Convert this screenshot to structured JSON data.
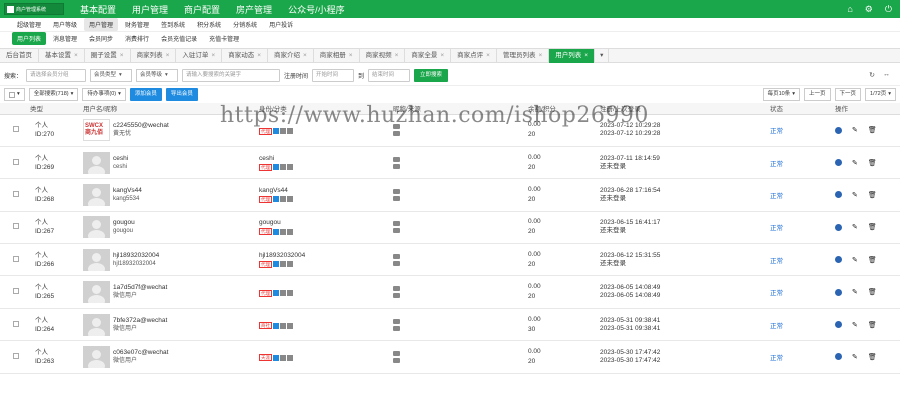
{
  "app": {
    "logo_text": "商户管理系统",
    "top_nav": [
      "基本配置",
      "用户管理",
      "商户配置",
      "房产管理",
      "公众号/小程序"
    ],
    "top_icons": [
      "home-icon",
      "gear-icon",
      "power-icon"
    ]
  },
  "subnav1": [
    "超级管理",
    "用户等级",
    "用户管理",
    "财务管理",
    "签到系统",
    "积分系统",
    "分销系统",
    "用户投诉"
  ],
  "subnav2": [
    "用户列表",
    "消息管理",
    "会员同步",
    "消费排行",
    "会员充值记录",
    "充值卡管理"
  ],
  "tabs": [
    {
      "label": "后台首页",
      "closable": false,
      "active": false
    },
    {
      "label": "基本设置",
      "closable": true,
      "active": false
    },
    {
      "label": "圈子设置",
      "closable": true,
      "active": false
    },
    {
      "label": "商家列表",
      "closable": true,
      "active": false
    },
    {
      "label": "入驻订单",
      "closable": true,
      "active": false
    },
    {
      "label": "商家动态",
      "closable": true,
      "active": false
    },
    {
      "label": "商家介绍",
      "closable": true,
      "active": false
    },
    {
      "label": "商家相册",
      "closable": true,
      "active": false
    },
    {
      "label": "商家视频",
      "closable": true,
      "active": false
    },
    {
      "label": "商家全景",
      "closable": true,
      "active": false
    },
    {
      "label": "商家点评",
      "closable": true,
      "active": false
    },
    {
      "label": "管理员列表",
      "closable": true,
      "active": false
    },
    {
      "label": "用户列表",
      "closable": true,
      "active": true
    }
  ],
  "search": {
    "label": "搜索：",
    "keyword_placeholder": "请选择会员分组",
    "member_type": "会员类型",
    "member_level": "会员等级",
    "input_placeholder": "请输入要搜索的关键字",
    "reg_time_label": "注册时间",
    "start_placeholder": "开始时间",
    "to": "到",
    "end_placeholder": "结束时间",
    "search_button": "立即搜索"
  },
  "actions": {
    "select_all": "全部搜索(718)",
    "batch": "待办事项(0)",
    "add_member": "添加会员",
    "import_member": "导出会员",
    "per_page": "每页10条",
    "prev": "上一页",
    "next": "下一页",
    "page": "1/72页"
  },
  "table": {
    "headers": [
      "类型",
      "用户名/昵称",
      "身份/分类",
      "昵称/来源",
      "余额/积分",
      "注册/上次登录",
      "状态",
      "操作"
    ],
    "rows": [
      {
        "type": "个人",
        "id": "ID:270",
        "name": "c2245550@wechat",
        "sub": "黄无忧",
        "cat": "",
        "tag": "代理",
        "bal": "0.00",
        "pts": "20",
        "t1": "2023-07-12 10:29:28",
        "t2": "2023-07-12 10:29:28",
        "status": "正常",
        "logo": true
      },
      {
        "type": "个人",
        "id": "ID:269",
        "name": "ceshi",
        "sub": "ceshi",
        "cat": "ceshi",
        "tag": "代理",
        "bal": "0.00",
        "pts": "20",
        "t1": "2023-07-11 18:14:59",
        "t2": "还未登录",
        "status": "正常",
        "logo": false
      },
      {
        "type": "个人",
        "id": "ID:268",
        "name": "kangVs44",
        "sub": "kang5534",
        "cat": "kangVs44",
        "tag": "代理",
        "bal": "0.00",
        "pts": "20",
        "t1": "2023-06-28 17:16:54",
        "t2": "还未登录",
        "status": "正常",
        "logo": false
      },
      {
        "type": "个人",
        "id": "ID:267",
        "name": "gougou",
        "sub": "gougou",
        "cat": "gougou",
        "tag": "代理",
        "bal": "0.00",
        "pts": "20",
        "t1": "2023-06-15 16:41:17",
        "t2": "还未登录",
        "status": "正常",
        "logo": false
      },
      {
        "type": "个人",
        "id": "ID:266",
        "name": "hjl18932032004",
        "sub": "hjl18932032004",
        "cat": "hjl18932032004",
        "tag": "代理",
        "bal": "0.00",
        "pts": "20",
        "t1": "2023-06-12 15:31:55",
        "t2": "还未登录",
        "status": "正常",
        "logo": false
      },
      {
        "type": "个人",
        "id": "ID:265",
        "name": "1a7d5d7f@wechat",
        "sub": "微信用户",
        "cat": "",
        "tag": "代理",
        "bal": "0.00",
        "pts": "20",
        "t1": "2023-06-05 14:08:49",
        "t2": "2023-06-05 14:08:49",
        "status": "正常",
        "logo": false
      },
      {
        "type": "个人",
        "id": "ID:264",
        "name": "7bfe372a@wechat",
        "sub": "微信用户",
        "cat": "",
        "tag": "商社",
        "bal": "0.00",
        "pts": "30",
        "t1": "2023-05-31 09:38:41",
        "t2": "2023-05-31 09:38:41",
        "status": "正常",
        "logo": false
      },
      {
        "type": "个人",
        "id": "ID:263",
        "name": "c063e07c@wechat",
        "sub": "微信用户",
        "cat": "",
        "tag": "天涯",
        "bal": "0.00",
        "pts": "20",
        "t1": "2023-05-30 17:47:42",
        "t2": "2023-05-30 17:47:42",
        "status": "正常",
        "logo": false
      }
    ]
  },
  "watermark": "https://www.huzhan.com/ishop26990"
}
